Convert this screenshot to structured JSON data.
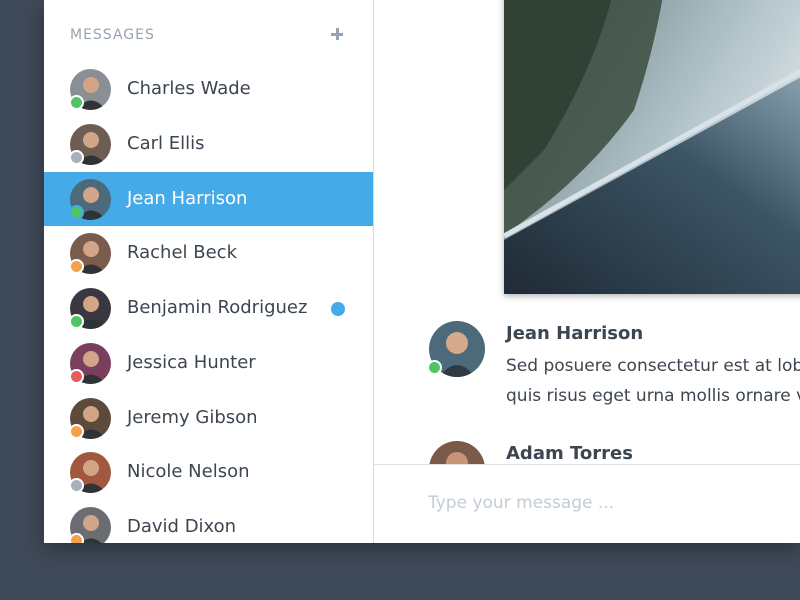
{
  "sidebar": {
    "title": "MESSAGES",
    "add_icon": "plus-icon",
    "contacts": [
      {
        "name": "Charles Wade",
        "status": "online",
        "status_color": "#4fc463",
        "avatar_bg": "#8a8f96",
        "unread": false,
        "active": false
      },
      {
        "name": "Carl Ellis",
        "status": "offline",
        "status_color": "#a7b0bc",
        "avatar_bg": "#6e5d52",
        "unread": false,
        "active": false
      },
      {
        "name": "Jean Harrison",
        "status": "online",
        "status_color": "#4fc463",
        "avatar_bg": "#4d6a7a",
        "unread": false,
        "active": true
      },
      {
        "name": "Rachel Beck",
        "status": "away",
        "status_color": "#f5a14c",
        "avatar_bg": "#7a5c4d",
        "unread": false,
        "active": false
      },
      {
        "name": "Benjamin Rodriguez",
        "status": "online",
        "status_color": "#4fc463",
        "avatar_bg": "#3b3740",
        "unread": true,
        "active": false
      },
      {
        "name": "Jessica Hunter",
        "status": "busy",
        "status_color": "#ea5b5b",
        "avatar_bg": "#7a3f5c",
        "unread": false,
        "active": false
      },
      {
        "name": "Jeremy Gibson",
        "status": "away",
        "status_color": "#f5a14c",
        "avatar_bg": "#5c4a3a",
        "unread": false,
        "active": false
      },
      {
        "name": "Nicole Nelson",
        "status": "offline",
        "status_color": "#a7b0bc",
        "avatar_bg": "#a0583f",
        "unread": false,
        "active": false
      },
      {
        "name": "David Dixon",
        "status": "away",
        "status_color": "#f5a14c",
        "avatar_bg": "#6a6e73",
        "unread": false,
        "active": false
      }
    ]
  },
  "chat": {
    "messages": [
      {
        "author": "Jean Harrison",
        "lines": [
          "Sed posuere consectetur est at lobortis.",
          "quis risus eget urna mollis ornare vel eu leo."
        ],
        "status_color": "#4fc463",
        "avatar_bg": "#4d6a7a"
      },
      {
        "author": "Adam Torres",
        "lines": [],
        "avatar_bg": "#7b5a4a"
      }
    ],
    "composer_placeholder": "Type your message ..."
  },
  "colors": {
    "accent": "#45abe8",
    "background": "#3f4a59",
    "text": "#3c4650",
    "muted": "#98a3b1"
  }
}
